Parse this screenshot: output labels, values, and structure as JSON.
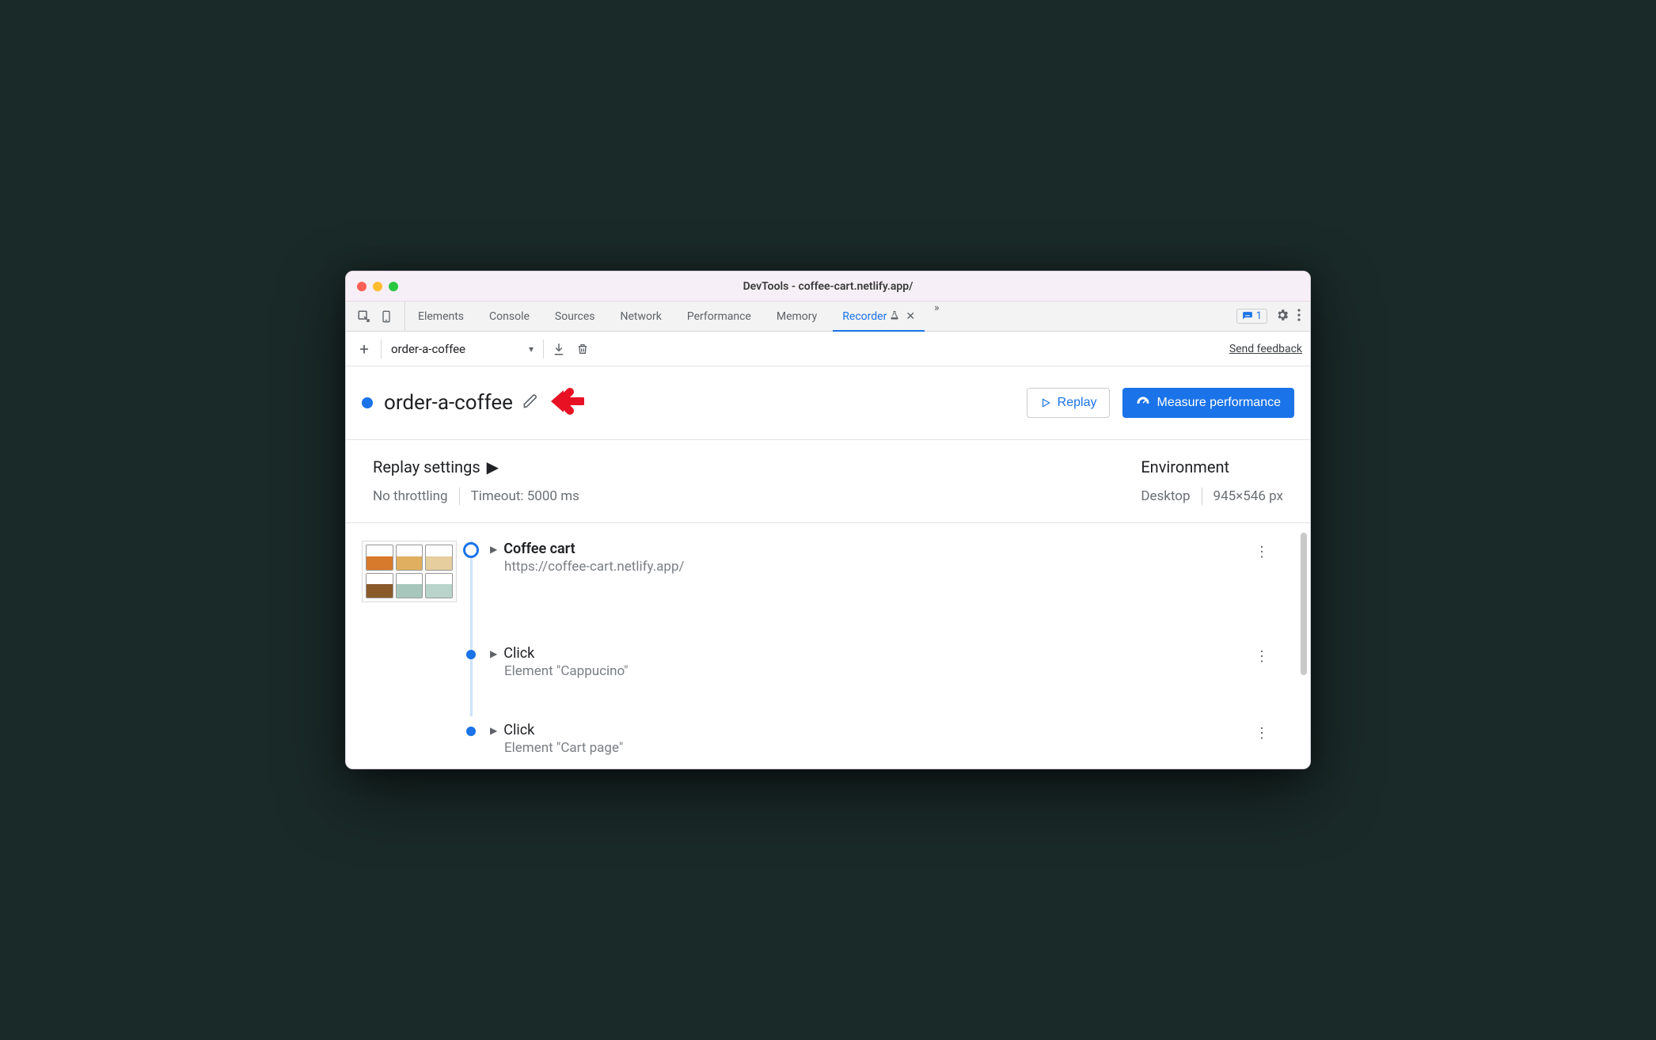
{
  "window": {
    "title": "DevTools - coffee-cart.netlify.app/"
  },
  "tabs": {
    "items": [
      "Elements",
      "Console",
      "Sources",
      "Network",
      "Performance",
      "Memory"
    ],
    "active": {
      "label": "Recorder"
    },
    "issues_count": "1"
  },
  "toolbar": {
    "recording_name": "order-a-coffee",
    "send_feedback": "Send feedback"
  },
  "header": {
    "title": "order-a-coffee",
    "replay_label": "Replay",
    "measure_label": "Measure performance"
  },
  "settings": {
    "replay_title": "Replay settings",
    "throttling": "No throttling",
    "timeout": "Timeout: 5000 ms",
    "env_title": "Environment",
    "device": "Desktop",
    "viewport": "945×546 px"
  },
  "steps": [
    {
      "title": "Coffee cart",
      "subtitle": "https://coffee-cart.netlify.app/",
      "bold": true,
      "marker": "ring",
      "thumb": true
    },
    {
      "title": "Click",
      "subtitle": "Element \"Cappucino\"",
      "bold": false,
      "marker": "dot",
      "thumb": false
    },
    {
      "title": "Click",
      "subtitle": "Element \"Cart page\"",
      "bold": false,
      "marker": "dot",
      "thumb": false
    }
  ]
}
